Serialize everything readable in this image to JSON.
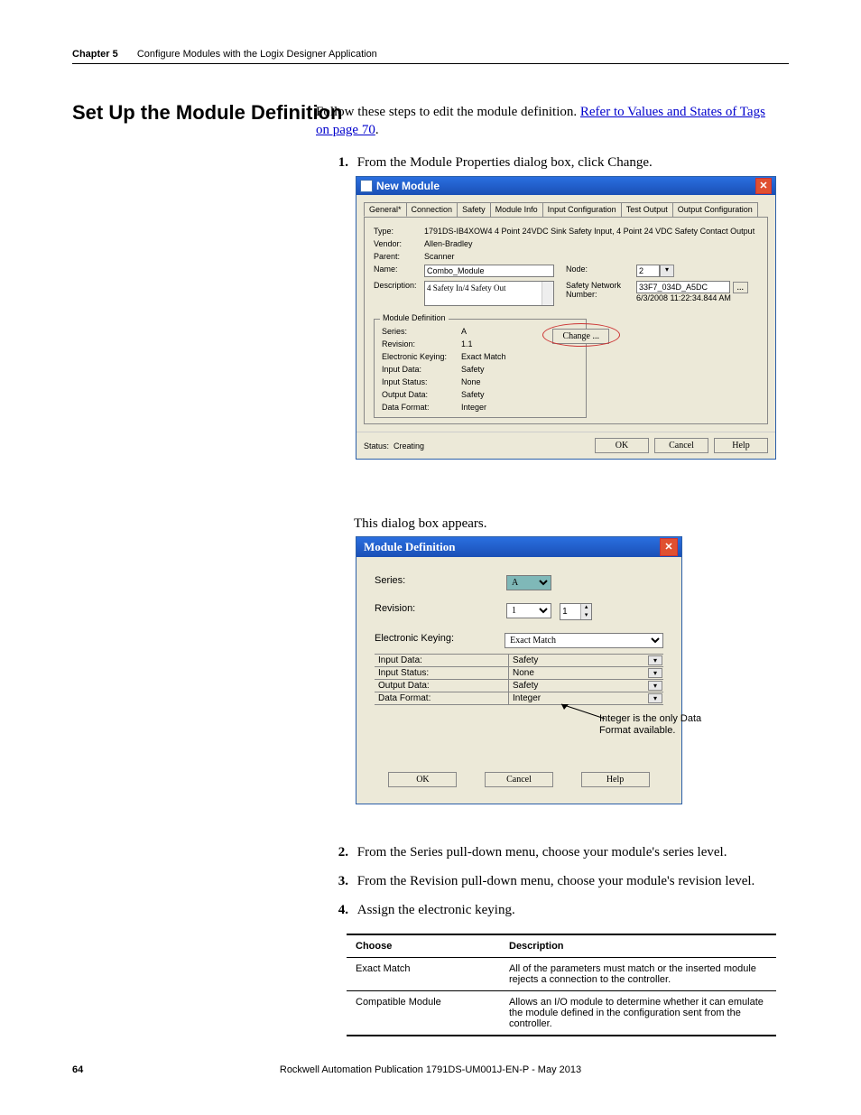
{
  "header": {
    "chapter_num": "Chapter 5",
    "chapter_title": "Configure Modules with the Logix Designer Application"
  },
  "section": {
    "heading": "Set Up the Module Definition"
  },
  "intro": {
    "lead": "Follow these steps to edit the module definition. ",
    "link": "Refer to Values and States of Tags on page 70",
    "period": "."
  },
  "steps": {
    "s1": {
      "num": "1.",
      "text": "From the Module Properties dialog box, click Change."
    },
    "s2": {
      "num": "2.",
      "text": "From the Series pull-down menu, choose your module's series level."
    },
    "s3": {
      "num": "3.",
      "text": "From the Revision pull-down menu, choose your module's revision level."
    },
    "s4": {
      "num": "4.",
      "text": "Assign the electronic keying."
    }
  },
  "mid_text": "This dialog box appears.",
  "new_module": {
    "title": "New Module",
    "tabs": {
      "general": "General*",
      "connection": "Connection",
      "safety": "Safety",
      "module_info": "Module Info",
      "input_conf": "Input Configuration",
      "test_output": "Test Output",
      "output_conf": "Output Configuration"
    },
    "labels": {
      "type": "Type:",
      "vendor": "Vendor:",
      "parent": "Parent:",
      "name": "Name:",
      "description": "Description:",
      "node": "Node:",
      "snn": "Safety Network Number:"
    },
    "values": {
      "type": "1791DS-IB4XOW4 4 Point 24VDC Sink Safety Input, 4 Point 24 VDC Safety Contact Output",
      "vendor": "Allen-Bradley",
      "parent": "Scanner",
      "name": "Combo_Module",
      "description": "4 Safety In/4 Safety Out",
      "node": "2",
      "snn": "33F7_034D_A5DC",
      "snn_time": "6/3/2008 11:22:34.844 AM"
    },
    "moddef": {
      "group_label": "Module Definition",
      "labels": {
        "series": "Series:",
        "revision": "Revision:",
        "ek": "Electronic Keying:",
        "input_data": "Input Data:",
        "input_status": "Input Status:",
        "output_data": "Output Data:",
        "data_format": "Data Format:"
      },
      "values": {
        "series": "A",
        "revision": "1.1",
        "ek": "Exact Match",
        "input_data": "Safety",
        "input_status": "None",
        "output_data": "Safety",
        "data_format": "Integer"
      },
      "change_btn": "Change ..."
    },
    "status": {
      "label": "Status:",
      "value": "Creating"
    },
    "buttons": {
      "ok": "OK",
      "cancel": "Cancel",
      "help": "Help",
      "snn_more": "..."
    }
  },
  "module_def": {
    "title": "Module Definition",
    "labels": {
      "series": "Series:",
      "revision": "Revision:",
      "ek": "Electronic Keying:",
      "input_data": "Input Data:",
      "input_status": "Input Status:",
      "output_data": "Output Data:",
      "data_format": "Data Format:"
    },
    "values": {
      "series": "A",
      "rev_major": "1",
      "rev_minor": "1",
      "ek": "Exact Match",
      "input_data": "Safety",
      "input_status": "None",
      "output_data": "Safety",
      "data_format": "Integer"
    },
    "buttons": {
      "ok": "OK",
      "cancel": "Cancel",
      "help": "Help"
    }
  },
  "callout": "Integer is the only Data Format available.",
  "ek_table": {
    "headers": {
      "choose": "Choose",
      "desc": "Description"
    },
    "rows": [
      {
        "choose": "Exact Match",
        "desc": "All of the parameters must match or the inserted module rejects a connection to the controller."
      },
      {
        "choose": "Compatible Module",
        "desc": "Allows an I/O module to determine whether it can emulate the module defined in the configuration sent from the controller."
      }
    ]
  },
  "footer": {
    "pub": "Rockwell Automation Publication 1791DS-UM001J-EN-P - May 2013",
    "page": "64"
  }
}
